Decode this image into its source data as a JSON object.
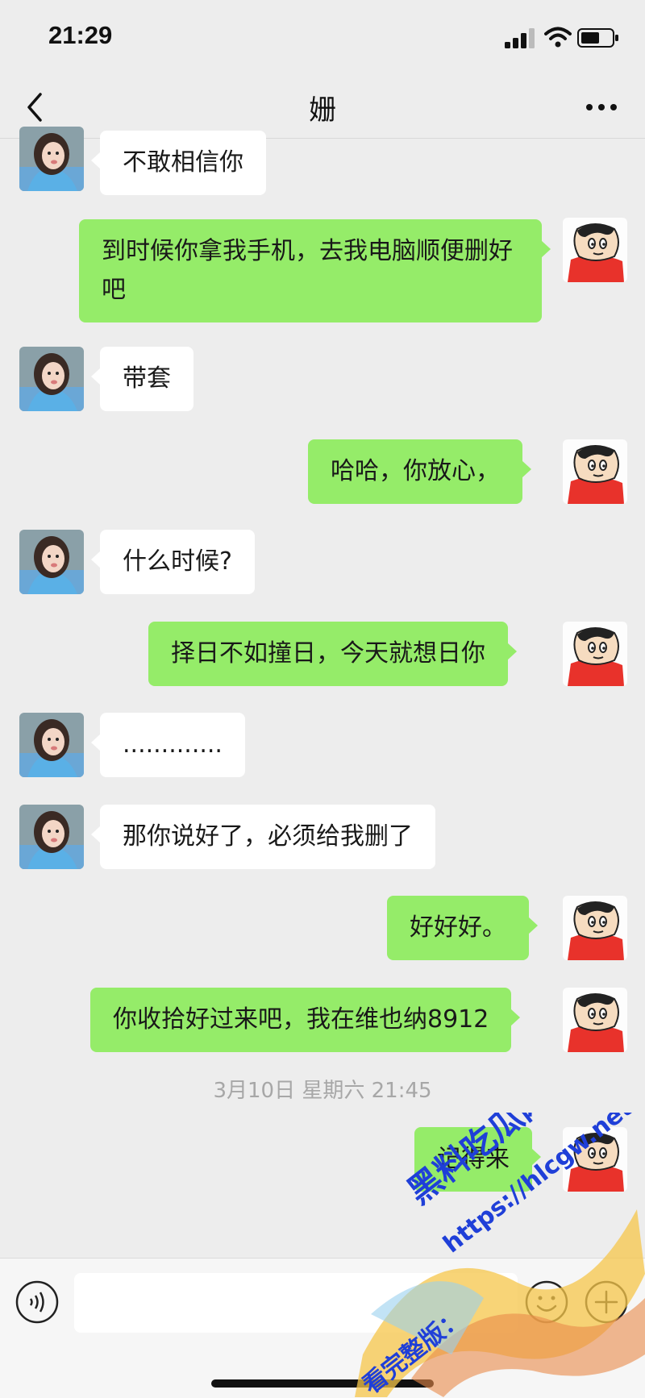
{
  "status_bar": {
    "time": "21:29"
  },
  "nav": {
    "title": "姗",
    "back_icon": "chevron-left-icon",
    "more_icon": "more-dots-icon"
  },
  "colors": {
    "incoming_bubble": "#ffffff",
    "outgoing_bubble": "#95ec69",
    "background": "#ededed"
  },
  "messages": [
    {
      "side": "in",
      "text": "不敢相信你"
    },
    {
      "side": "out",
      "text": "到时候你拿我手机，去我电脑顺便删好吧"
    },
    {
      "side": "in",
      "text": "带套"
    },
    {
      "side": "out",
      "text": "哈哈，你放心，"
    },
    {
      "side": "in",
      "text": "什么时候?"
    },
    {
      "side": "out",
      "text": "择日不如撞日，今天就想日你"
    },
    {
      "side": "in",
      "text": "............."
    },
    {
      "side": "in",
      "text": "那你说好了，必须给我删了"
    },
    {
      "side": "out",
      "text": "好好好。"
    },
    {
      "side": "out",
      "text": "你收拾好过来吧，我在维也纳8912"
    },
    {
      "side": "out",
      "text": "记得来"
    }
  ],
  "timestamp": "3月10日 星期六 21:45",
  "input_bar": {
    "voice_icon": "voice-icon",
    "emoji_icon": "emoji-icon",
    "plus_icon": "plus-icon",
    "text_value": ""
  },
  "watermark": {
    "line1": "黑料吃瓜网",
    "line2": "https://hlcgw.net",
    "line3": "看完整版："
  }
}
